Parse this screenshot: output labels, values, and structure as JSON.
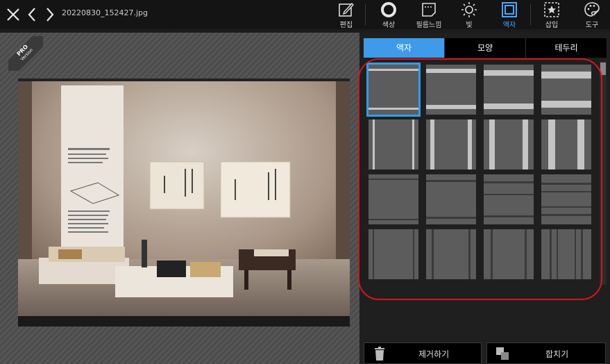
{
  "header": {
    "filename": "20220830_152427.jpg",
    "close_icon": "close-x-icon",
    "back_icon": "chevron-left-icon",
    "forward_icon": "chevron-right-icon"
  },
  "toolbar": {
    "items": [
      {
        "label": "편집",
        "icon": "edit-icon"
      },
      {
        "label": "색상",
        "icon": "color-circle-icon"
      },
      {
        "label": "필름느낌",
        "icon": "film-icon"
      },
      {
        "label": "빛",
        "icon": "sun-icon"
      },
      {
        "label": "액자",
        "icon": "frame-icon",
        "active": true
      },
      {
        "label": "삽입",
        "icon": "insert-star-icon"
      },
      {
        "label": "도구",
        "icon": "palette-tool-icon"
      }
    ],
    "active_color": "#4aa7ff"
  },
  "badge": {
    "line1": "PRO",
    "line2": "Version"
  },
  "panel": {
    "tabs": [
      {
        "label": "액자",
        "active": true
      },
      {
        "label": "모양",
        "active": false
      },
      {
        "label": "테두리",
        "active": false
      }
    ],
    "accent_color": "#3d9be9",
    "frame_count": 16,
    "selected_frame_index": 0
  },
  "actions": {
    "remove_label": "제거하기",
    "remove_icon": "trash-icon",
    "merge_label": "합치기",
    "merge_icon": "merge-squares-icon"
  },
  "annotation_color": "#d3161b"
}
